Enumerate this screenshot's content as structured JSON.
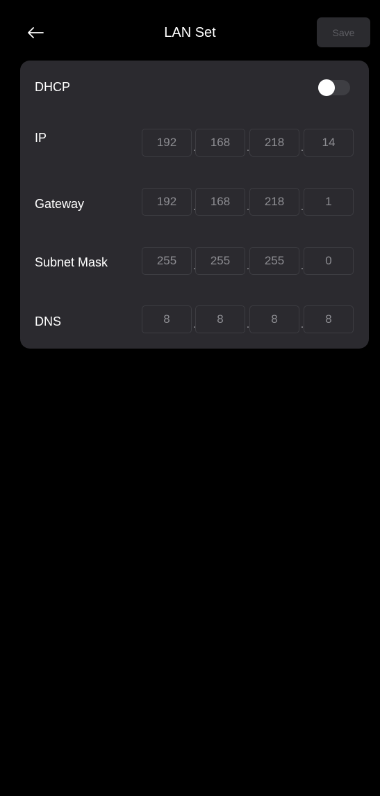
{
  "header": {
    "title": "LAN Set",
    "save_label": "Save",
    "back_icon": "arrow-left-icon"
  },
  "dhcp": {
    "label": "DHCP",
    "enabled": false
  },
  "fields": {
    "ip": {
      "label": "IP",
      "octets": [
        "192",
        "168",
        "218",
        "14"
      ]
    },
    "gateway": {
      "label": "Gateway",
      "octets": [
        "192",
        "168",
        "218",
        "1"
      ]
    },
    "subnet": {
      "label": "Subnet Mask",
      "octets": [
        "255",
        "255",
        "255",
        "0"
      ]
    },
    "dns": {
      "label": "DNS",
      "octets": [
        "8",
        "8",
        "8",
        "8"
      ]
    }
  },
  "separator": ".",
  "colors": {
    "background": "#000000",
    "card": "#2b2a2f",
    "input_border": "#3d3d42",
    "input_text": "#8d8d92",
    "save_disabled_text": "#5f5f64"
  }
}
